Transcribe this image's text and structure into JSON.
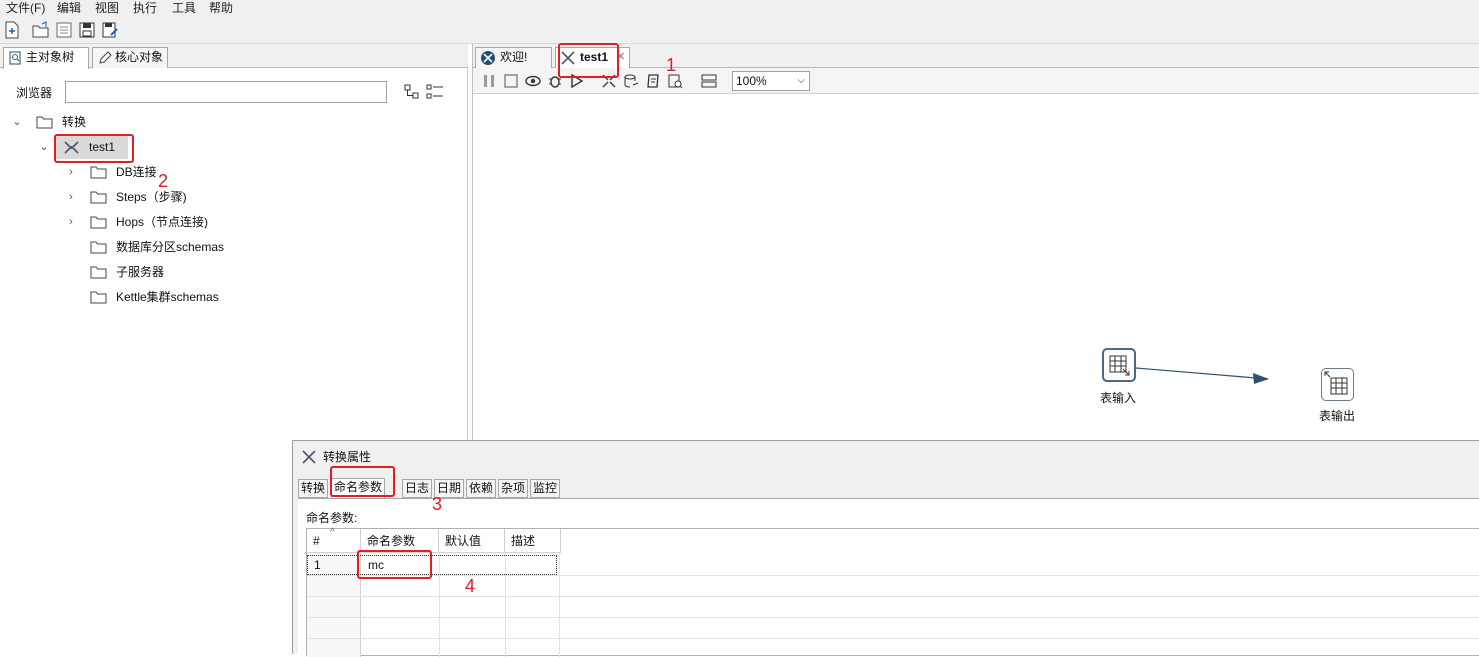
{
  "menu": {
    "items": [
      "文件(F)",
      "编辑",
      "视图",
      "执行",
      "工具",
      "帮助"
    ]
  },
  "left_panel": {
    "tabs": [
      "主对象树",
      "核心对象"
    ],
    "browser_label": "浏览器",
    "browser_value": "",
    "tree": {
      "root": "转换",
      "transform": "test1",
      "children": [
        "DB连接",
        "Steps（步骤)",
        "Hops（节点连接)",
        "数据库分区schemas",
        "子服务器",
        "Kettle集群schemas"
      ]
    }
  },
  "editor": {
    "tabs": [
      "欢迎!",
      "test1"
    ],
    "zoom": "100%",
    "steps": {
      "input_label": "表输入",
      "output_label": "表输出"
    }
  },
  "dialog": {
    "title": "转换属性",
    "tabs": [
      "转换",
      "命名参数",
      "日志",
      "日期",
      "依赖",
      "杂项",
      "监控"
    ],
    "params_label": "命名参数:",
    "table": {
      "headers": [
        "#",
        "命名参数",
        "默认值",
        "描述"
      ],
      "rows": [
        {
          "index": "1",
          "name": "mc",
          "default": "",
          "desc": ""
        }
      ]
    }
  },
  "annotations": [
    "1",
    "2",
    "3",
    "4"
  ],
  "colors": {
    "annotation": "#e02020",
    "step_border": "#4a6a85",
    "hop": "#2f4f6f"
  }
}
